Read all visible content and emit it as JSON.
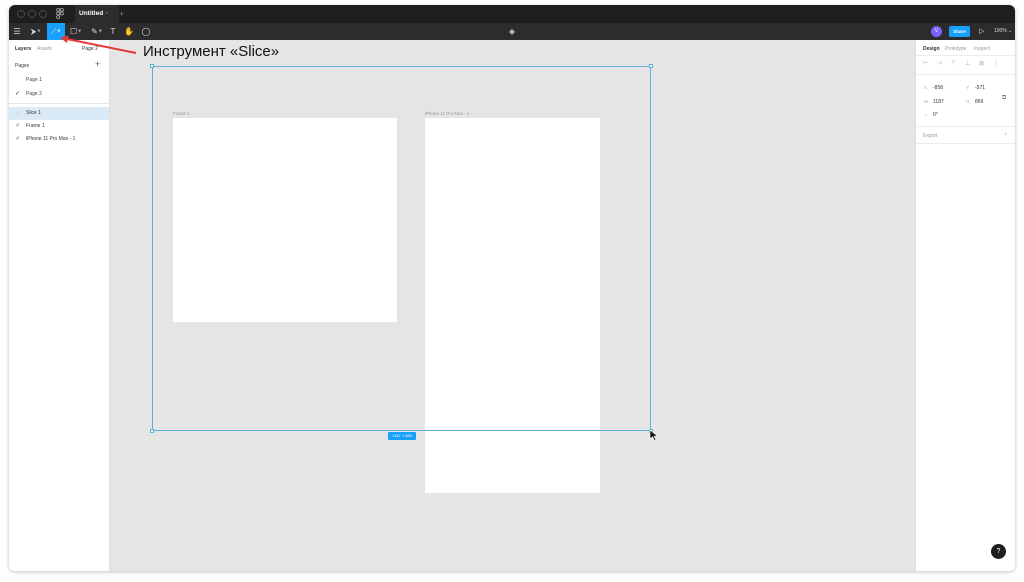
{
  "titlebar": {
    "doc_tab_label": "Untitled",
    "doc_tab_close": "×",
    "new_tab": "+"
  },
  "toolbar": {
    "menu_glyph": "☰",
    "move_glyph": "⮞",
    "slice_glyph": "⟋",
    "frame_glyph": "☐",
    "pen_glyph": "✎",
    "text_glyph": "T",
    "hand_glyph": "✋",
    "comment_glyph": "◯",
    "components_glyph": "◈",
    "avatar_letter": "V",
    "share_label": "Share",
    "play_glyph": "▷",
    "zoom_label": "100% ⌄"
  },
  "left_panel": {
    "tabs": [
      "Layers",
      "Assets"
    ],
    "current_page": "Page 2",
    "pages_header": "Pages",
    "add_page": "+",
    "pages": [
      "Page 1",
      "Page 2"
    ],
    "check_glyph": "✓",
    "layers": [
      {
        "label": "Slice 1",
        "icon": "slice-icon",
        "glyph": "◌",
        "selected": true
      },
      {
        "label": "Frame 1",
        "icon": "frame-icon",
        "glyph": "#",
        "selected": false
      },
      {
        "label": "iPhone 11 Pro Max - 1",
        "icon": "frame-icon",
        "glyph": "#",
        "selected": false
      }
    ]
  },
  "right_panel": {
    "tabs": [
      "Design",
      "Prototype",
      "Inspect"
    ],
    "align_glyphs": [
      "⊢",
      "⊣",
      "⊤",
      "⊥",
      "⊞",
      "⋮"
    ],
    "props": {
      "x_label": "X",
      "x_value": "-858",
      "y_label": "Y",
      "y_value": "-571",
      "w_label": "W",
      "w_value": "1187",
      "h_label": "H",
      "h_value": "869",
      "r_label": "∟",
      "r_value": "0°"
    },
    "clip_glyph": "⧉",
    "export_label": "Export",
    "export_add": "+",
    "help_label": "?"
  },
  "canvas": {
    "frames": [
      {
        "label": "Frame 1"
      },
      {
        "label": "iPhone 11 Pro Max - 1"
      }
    ],
    "slice_size_badge": "1187 × 869"
  },
  "annotation": {
    "text": "Инструмент «Slice»",
    "color": "#e53935"
  },
  "colors": {
    "accent": "#18a0fb",
    "titlebar": "#1e1e1e",
    "toolbar": "#2c2c2c",
    "canvas": "#e5e5e5",
    "selection": "#5fb0d6"
  }
}
